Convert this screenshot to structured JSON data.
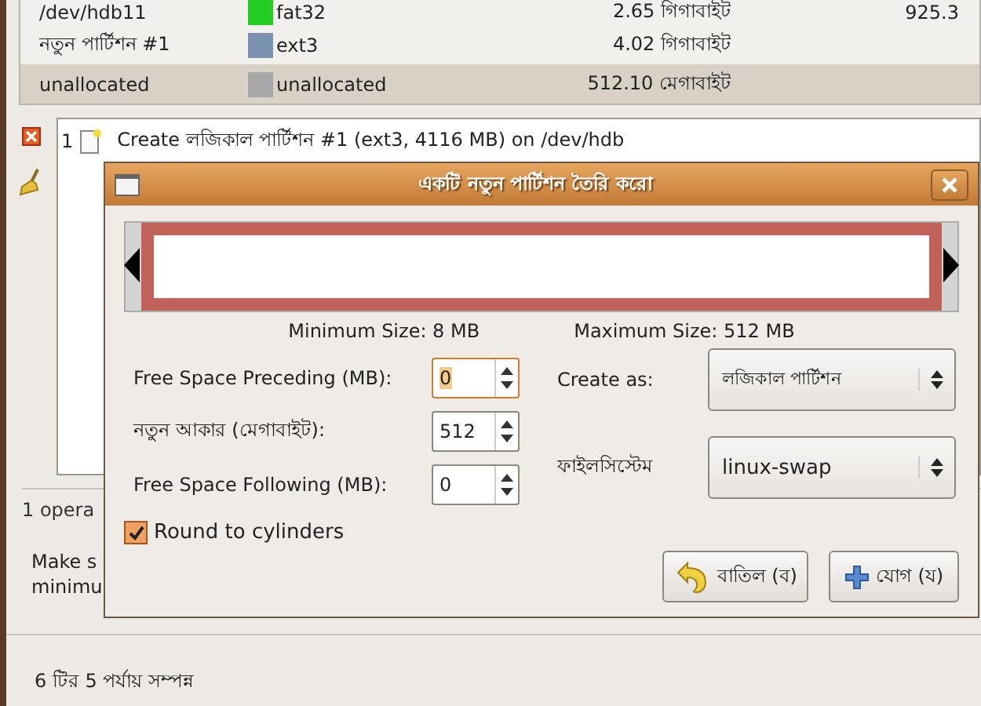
{
  "partitions": [
    {
      "name": "/dev/hdb11",
      "color": "#22cc22",
      "filesystem": "fat32",
      "size": "2.65 গিগাবাইট",
      "column_4": "925.3",
      "selected": false
    },
    {
      "name": "নতুন পার্টিশন #1",
      "color": "#7b92b0",
      "filesystem": "ext3",
      "size": "4.02 গিগাবাইট",
      "selected": false
    },
    {
      "name": "unallocated",
      "color": "#a8a8a8",
      "filesystem": "unallocated",
      "size": "512.10 মেগাবাইট",
      "selected": true
    }
  ],
  "operations": [
    {
      "number": "1",
      "text": "Create লজিকাল পার্টিশন #1 (ext3, 4116 MB) on /dev/hdb"
    }
  ],
  "operations_count": "1 opera",
  "message": [
    "Make s",
    "minimu"
  ],
  "status": "6 টির 5 পর্যায় সম্পন্ন",
  "dialog": {
    "title": "একটি নতুন পার্টিশন তৈরি করো",
    "min_size": "Minimum Size: 8 MB",
    "max_size": "Maximum Size: 512 MB",
    "spins": [
      {
        "label": "Free Space Preceding (MB):",
        "value": "0",
        "focused": true
      },
      {
        "label": "নতুন আকার (মেগাবাইট):",
        "value": "512",
        "focused": false
      },
      {
        "label": "Free Space Following (MB):",
        "value": "0",
        "focused": false
      }
    ],
    "combos": [
      {
        "label": "Create as:",
        "value": "লজিকাল পার্টিশন"
      },
      {
        "label": "ফাইলসিস্টেম",
        "value": "linux-swap"
      }
    ],
    "round": {
      "label": "Round to cylinders",
      "checked": true
    },
    "buttons": [
      {
        "kind": "cancel",
        "label": "বাতিল (ব)"
      },
      {
        "kind": "add",
        "label": "যোগ (য)"
      }
    ]
  }
}
